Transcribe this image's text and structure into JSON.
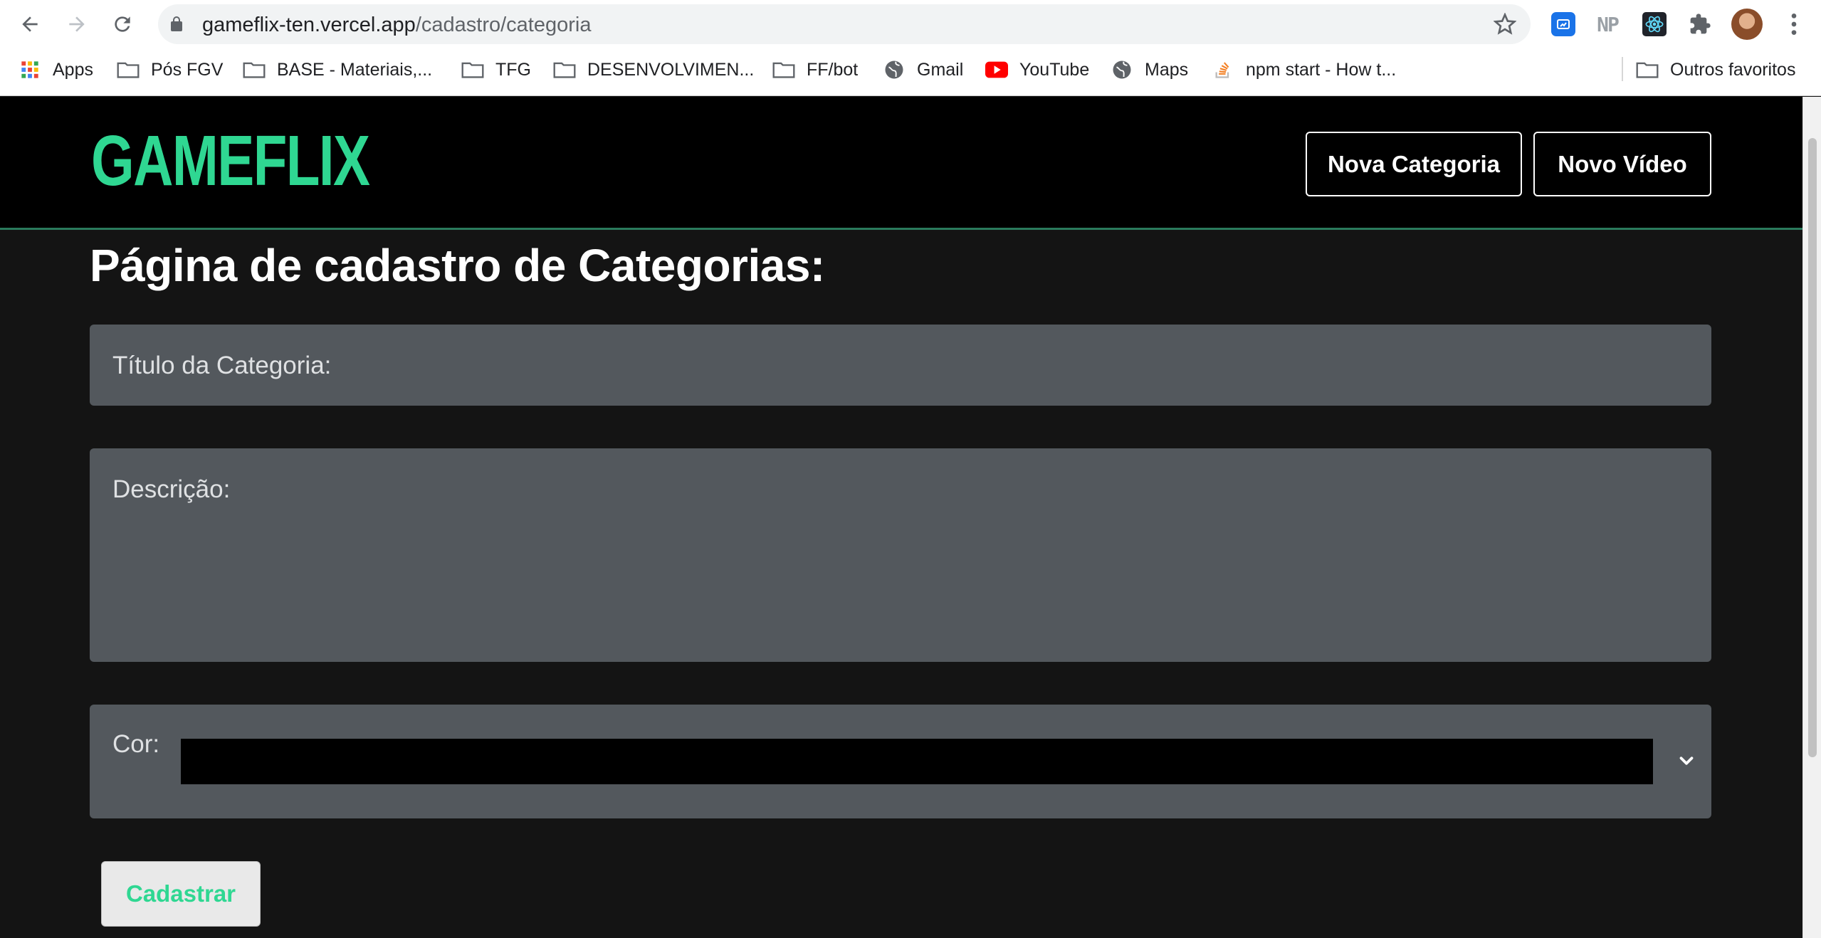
{
  "browser": {
    "url_host": "gameflix-ten.vercel.app",
    "url_path": "/cadastro/categoria",
    "extensions": {
      "np_label": "NP"
    },
    "bookmarks": [
      {
        "label": "Apps",
        "icon": "apps-grid-icon"
      },
      {
        "label": "Pós FGV",
        "icon": "folder-icon"
      },
      {
        "label": "BASE - Materiais,...",
        "icon": "folder-icon"
      },
      {
        "label": "TFG",
        "icon": "folder-icon"
      },
      {
        "label": "DESENVOLVIMEN...",
        "icon": "folder-icon"
      },
      {
        "label": "FF/bot",
        "icon": "folder-icon"
      },
      {
        "label": "Gmail",
        "icon": "globe-icon"
      },
      {
        "label": "YouTube",
        "icon": "youtube-icon"
      },
      {
        "label": "Maps",
        "icon": "globe-icon"
      },
      {
        "label": "npm start - How t...",
        "icon": "stackoverflow-icon"
      }
    ],
    "other_bookmarks": "Outros favoritos"
  },
  "header": {
    "logo": "GAMEFLIX",
    "nav": {
      "nova_categoria": "Nova Categoria",
      "novo_video": "Novo Vídeo"
    }
  },
  "form": {
    "title": "Página de cadastro de Categorias:",
    "titulo_label": "Título da Categoria:",
    "titulo_value": "",
    "descricao_label": "Descrição:",
    "descricao_value": "",
    "cor_label": "Cor:",
    "cor_value": "#000000",
    "submit": "Cadastrar"
  },
  "colors": {
    "brand": "#2fd792",
    "header_bg": "#000000",
    "page_bg": "#141414",
    "field_bg": "#53585d"
  }
}
